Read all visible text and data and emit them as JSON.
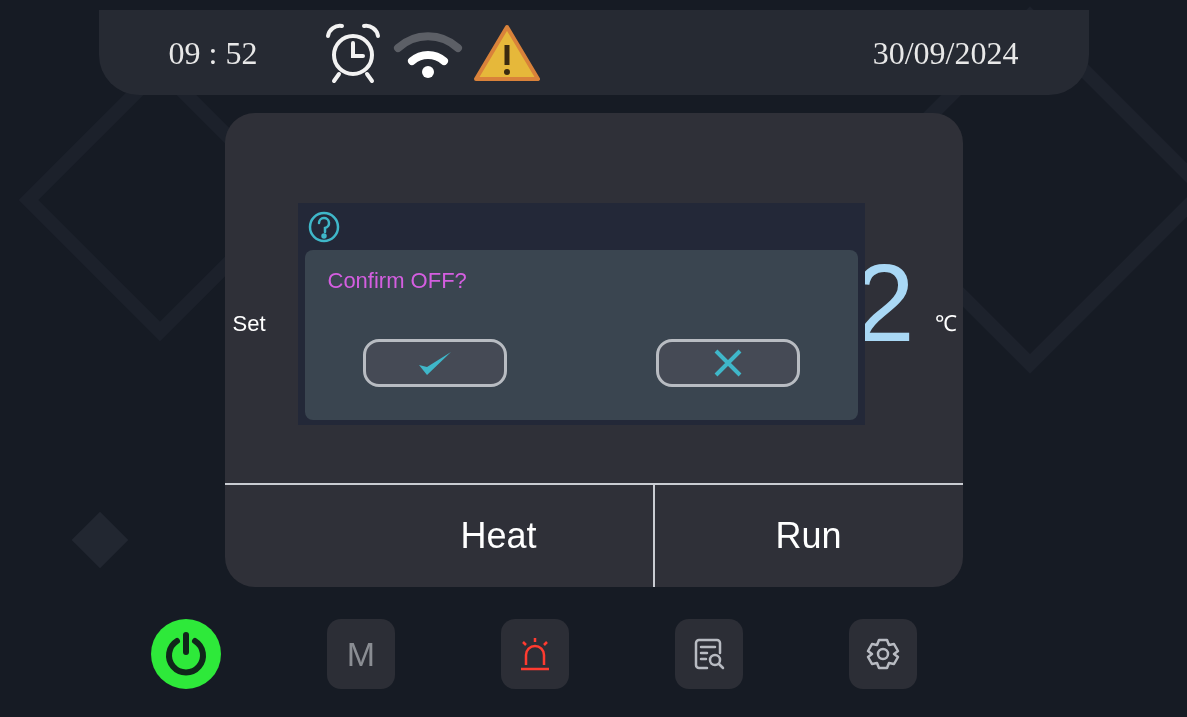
{
  "status_bar": {
    "time": "09 : 52",
    "icons": [
      {
        "kind": "alarm-clock"
      },
      {
        "kind": "wifi"
      },
      {
        "kind": "warning"
      }
    ],
    "date": "30/09/2024"
  },
  "setpoint": {
    "label": "Set",
    "value": "2",
    "unit": "℃"
  },
  "modes": [
    {
      "label": "Heat"
    },
    {
      "label": "Run"
    }
  ],
  "dialog": {
    "message": "Confirm OFF?",
    "buttons": [
      {
        "kind": "confirm"
      },
      {
        "kind": "cancel"
      }
    ]
  },
  "nav": [
    {
      "kind": "power",
      "on": true
    },
    {
      "kind": "mode",
      "label": "M"
    },
    {
      "kind": "alarm",
      "active": true
    },
    {
      "kind": "records"
    },
    {
      "kind": "settings"
    }
  ]
}
